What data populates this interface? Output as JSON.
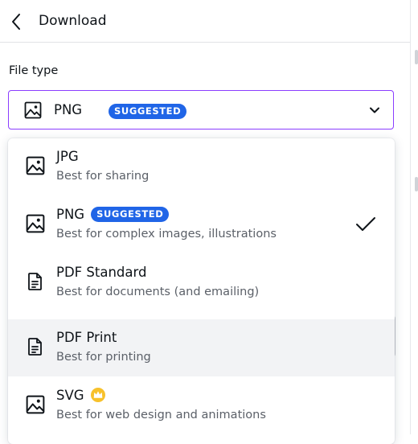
{
  "header": {
    "title": "Download",
    "back_icon": "chevron-left-icon"
  },
  "file_type": {
    "label": "File type",
    "selected": {
      "value": "PNG",
      "badge": "SUGGESTED",
      "icon": "image-icon"
    }
  },
  "colors": {
    "accent": "#8b3dff",
    "badge": "#2065e7",
    "hover": "#f2f3f5",
    "crown": "#f7c12b"
  },
  "options": [
    {
      "name": "JPG",
      "desc": "Best for sharing",
      "icon": "image-icon"
    },
    {
      "name": "PNG",
      "badge": "SUGGESTED",
      "desc": "Best for complex images, illustrations",
      "icon": "image-icon",
      "selected": true
    },
    {
      "name": "PDF Standard",
      "desc": "Best for documents (and emailing)",
      "icon": "document-icon"
    },
    {
      "name": "PDF Print",
      "desc": "Best for printing",
      "icon": "document-icon",
      "hovered": true
    },
    {
      "name": "SVG",
      "desc": "Best for web design and animations",
      "icon": "image-icon",
      "premium_icon": "crown-icon"
    }
  ]
}
